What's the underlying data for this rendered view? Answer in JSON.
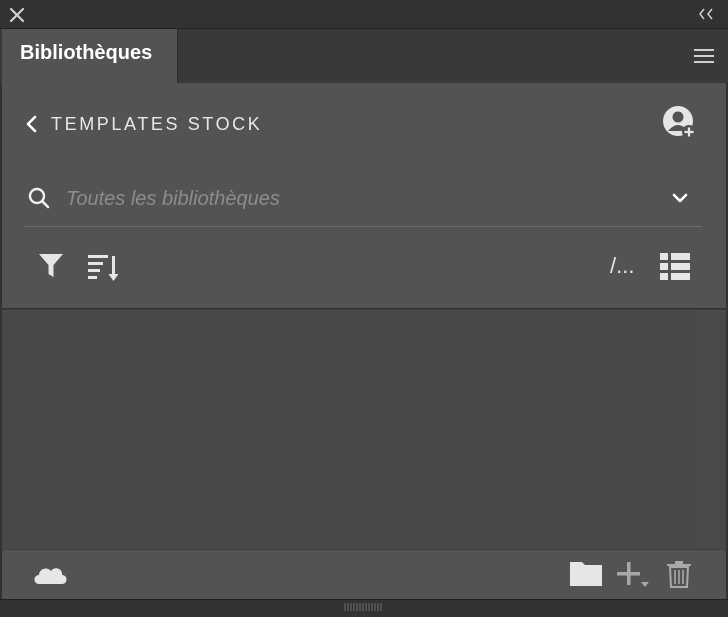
{
  "window": {
    "close_icon": "close-icon",
    "collapse_icon": "double-chevron-left-icon"
  },
  "tab": {
    "label": "Bibliothèques",
    "menu_icon": "hamburger-menu-icon"
  },
  "library": {
    "back_icon": "chevron-left-icon",
    "title": "TEMPLATES STOCK",
    "share_icon": "add-user-icon"
  },
  "search": {
    "placeholder": "Toutes les bibliothèques",
    "value": "",
    "icon": "search-icon",
    "dropdown_icon": "chevron-down-icon"
  },
  "toolbar": {
    "filter_icon": "filter-icon",
    "sort_icon": "sort-icon",
    "path_label": "/...",
    "view_icon": "list-view-icon"
  },
  "footer": {
    "cloud_icon": "cloud-icon",
    "folder_icon": "folder-icon",
    "add_icon": "plus-dropdown-icon",
    "delete_icon": "trash-icon"
  },
  "colors": {
    "background": "#323232",
    "panel": "#535353",
    "empty_area": "#484848",
    "text": "#e8e8e8",
    "placeholder": "#8c8c8c"
  }
}
